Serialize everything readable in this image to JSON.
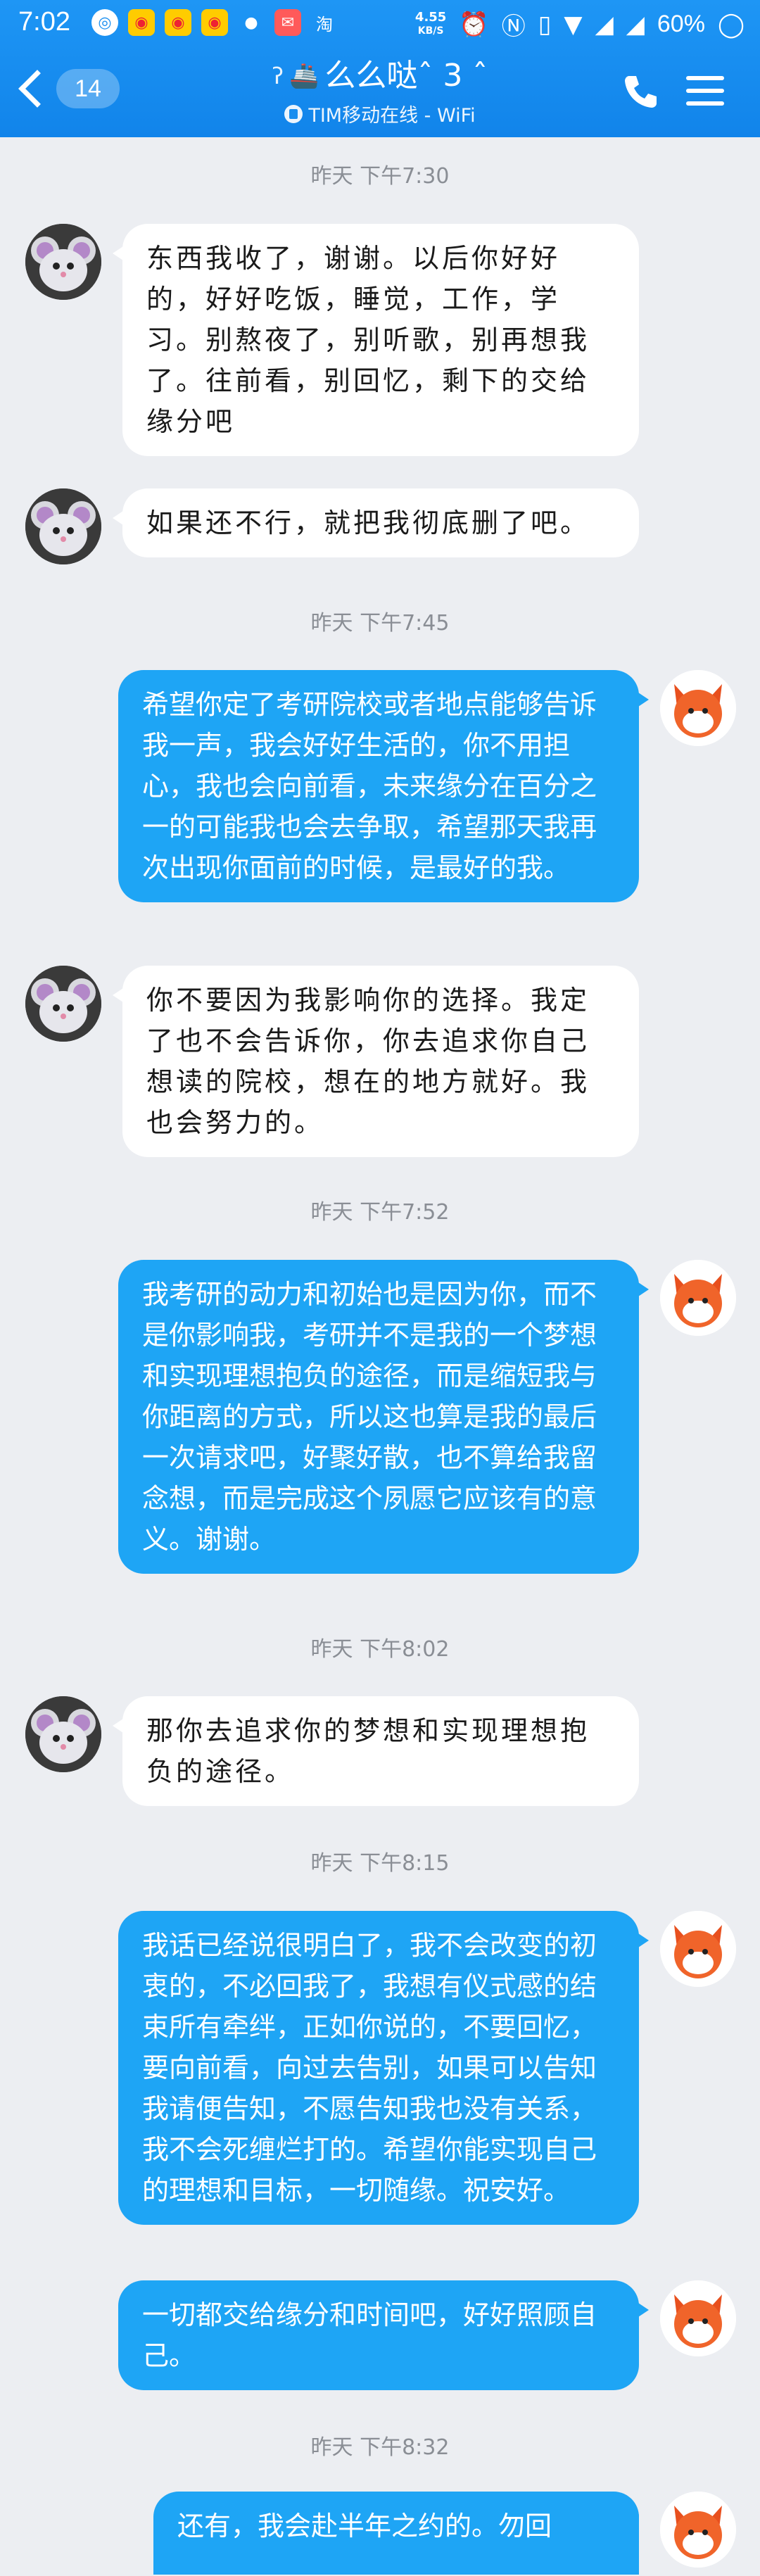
{
  "status_bar": {
    "time": "7:02",
    "net_speed": "4.55",
    "net_unit": "KB/S",
    "battery": "60%"
  },
  "header": {
    "unread_count": "14",
    "contact_name": "么么哒ˆ 3 ˆ",
    "status_text": "TIM移动在线 - WiFi"
  },
  "messages": [
    {
      "type": "time",
      "text": "昨天 下午7:30"
    },
    {
      "type": "in",
      "text": "东西我收了，谢谢。以后你好好的，好好吃饭，睡觉，工作，学习。别熬夜了，别听歌，别再想我了。往前看，别回忆，剩下的交给缘分吧"
    },
    {
      "type": "in",
      "text": "如果还不行，就把我彻底删了吧。"
    },
    {
      "type": "time",
      "text": "昨天 下午7:45"
    },
    {
      "type": "out",
      "text": "希望你定了考研院校或者地点能够告诉我一声，我会好好生活的，你不用担心，我也会向前看，未来缘分在百分之一的可能我也会去争取，希望那天我再次出现你面前的时候，是最好的我。"
    },
    {
      "type": "in",
      "text": "你不要因为我影响你的选择。我定了也不会告诉你，你去追求你自己想读的院校，想在的地方就好。我也会努力的。"
    },
    {
      "type": "time",
      "text": "昨天 下午7:52"
    },
    {
      "type": "out",
      "text": "我考研的动力和初始也是因为你，而不是你影响我，考研并不是我的一个梦想和实现理想抱负的途径，而是缩短我与你距离的方式，所以这也算是我的最后一次请求吧，好聚好散，也不算给我留念想，而是完成这个夙愿它应该有的意义。谢谢。"
    },
    {
      "type": "time",
      "text": "昨天 下午8:02"
    },
    {
      "type": "in",
      "text": "那你去追求你的梦想和实现理想抱负的途径。"
    },
    {
      "type": "time",
      "text": "昨天 下午8:15"
    },
    {
      "type": "out",
      "text": "我话已经说很明白了，我不会改变的初衷的，不必回我了，我想有仪式感的结束所有牵绊，正如你说的，不要回忆，要向前看，向过去告别，如果可以告知我请便告知，不愿告知我也没有关系，我不会死缠烂打的。希望你能实现自己的理想和目标，一切随缘。祝安好。"
    },
    {
      "type": "out",
      "text": "一切都交给缘分和时间吧，好好照顾自己。"
    },
    {
      "type": "time",
      "text": "昨天 下午8:32"
    },
    {
      "type": "out",
      "text": "还有，我会赴半年之约的。勿回"
    }
  ],
  "colors": {
    "header": "#1a8ff0",
    "outgoing_bubble": "#1ea5f5",
    "incoming_bubble": "#ffffff",
    "background": "#eceef2"
  }
}
